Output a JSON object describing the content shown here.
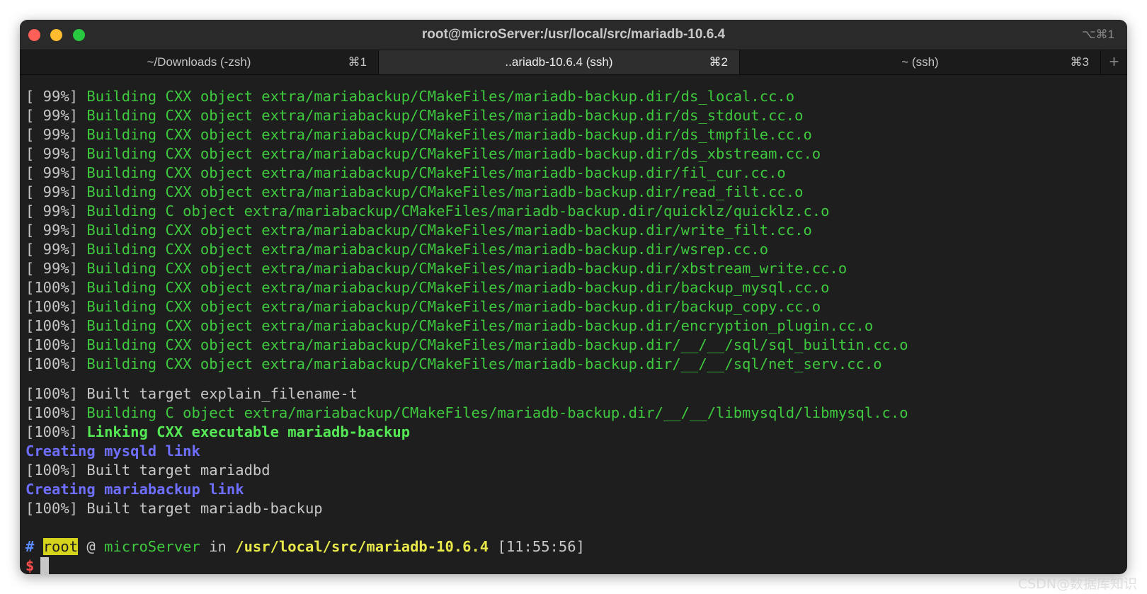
{
  "window": {
    "title": "root@microServer:/usr/local/src/mariadb-10.6.4",
    "shortcut": "⌥⌘1"
  },
  "tabs": [
    {
      "label": "~/Downloads (-zsh)",
      "key": "⌘1"
    },
    {
      "label": "..ariadb-10.6.4 (ssh)",
      "key": "⌘2"
    },
    {
      "label": "~ (ssh)",
      "key": "⌘3"
    }
  ],
  "new_tab": "+",
  "terminal": {
    "build_lines": [
      {
        "pct": "[ 99%] ",
        "text": "Building CXX object extra/mariabackup/CMakeFiles/mariadb-backup.dir/ds_local.cc.o"
      },
      {
        "pct": "[ 99%] ",
        "text": "Building CXX object extra/mariabackup/CMakeFiles/mariadb-backup.dir/ds_stdout.cc.o"
      },
      {
        "pct": "[ 99%] ",
        "text": "Building CXX object extra/mariabackup/CMakeFiles/mariadb-backup.dir/ds_tmpfile.cc.o"
      },
      {
        "pct": "[ 99%] ",
        "text": "Building CXX object extra/mariabackup/CMakeFiles/mariadb-backup.dir/ds_xbstream.cc.o"
      },
      {
        "pct": "[ 99%] ",
        "text": "Building CXX object extra/mariabackup/CMakeFiles/mariadb-backup.dir/fil_cur.cc.o"
      },
      {
        "pct": "[ 99%] ",
        "text": "Building CXX object extra/mariabackup/CMakeFiles/mariadb-backup.dir/read_filt.cc.o"
      },
      {
        "pct": "[ 99%] ",
        "text": "Building C object extra/mariabackup/CMakeFiles/mariadb-backup.dir/quicklz/quicklz.c.o"
      },
      {
        "pct": "[ 99%] ",
        "text": "Building CXX object extra/mariabackup/CMakeFiles/mariadb-backup.dir/write_filt.cc.o"
      },
      {
        "pct": "[ 99%] ",
        "text": "Building CXX object extra/mariabackup/CMakeFiles/mariadb-backup.dir/wsrep.cc.o"
      },
      {
        "pct": "[ 99%] ",
        "text": "Building CXX object extra/mariabackup/CMakeFiles/mariadb-backup.dir/xbstream_write.cc.o"
      },
      {
        "pct": "[100%] ",
        "text": "Building CXX object extra/mariabackup/CMakeFiles/mariadb-backup.dir/backup_mysql.cc.o"
      },
      {
        "pct": "[100%] ",
        "text": "Building CXX object extra/mariabackup/CMakeFiles/mariadb-backup.dir/backup_copy.cc.o"
      },
      {
        "pct": "[100%] ",
        "text": "Building CXX object extra/mariabackup/CMakeFiles/mariadb-backup.dir/encryption_plugin.cc.o"
      },
      {
        "pct": "[100%] ",
        "text": "Building CXX object extra/mariabackup/CMakeFiles/mariadb-backup.dir/__/__/sql/sql_builtin.cc.o"
      },
      {
        "pct": "[100%] ",
        "text": "Building CXX object extra/mariabackup/CMakeFiles/mariadb-backup.dir/__/__/sql/net_serv.cc.o"
      }
    ],
    "built_explain": {
      "pct": "[100%] ",
      "text": "Built target explain_filename-t"
    },
    "build_libmysql": {
      "pct": "[100%] ",
      "text": "Building C object extra/mariabackup/CMakeFiles/mariadb-backup.dir/__/__/libmysqld/libmysql.c.o"
    },
    "linking": {
      "pct": "[100%] ",
      "text": "Linking CXX executable mariadb-backup"
    },
    "creating_mysqld": "Creating mysqld link",
    "built_mariadbd": {
      "pct": "[100%] ",
      "text": "Built target mariadbd"
    },
    "creating_mariabackup": "Creating mariabackup link",
    "built_backup": {
      "pct": "[100%] ",
      "text": "Built target mariadb-backup"
    },
    "prompt": {
      "hash": "#",
      "user": "root",
      "at": " @ ",
      "host": "microServer",
      "in": " in ",
      "path": "/usr/local/src/mariadb-10.6.4",
      "time": " [11:55:56]",
      "dollar": "$"
    }
  },
  "watermark": "CSDN@数据库知识"
}
